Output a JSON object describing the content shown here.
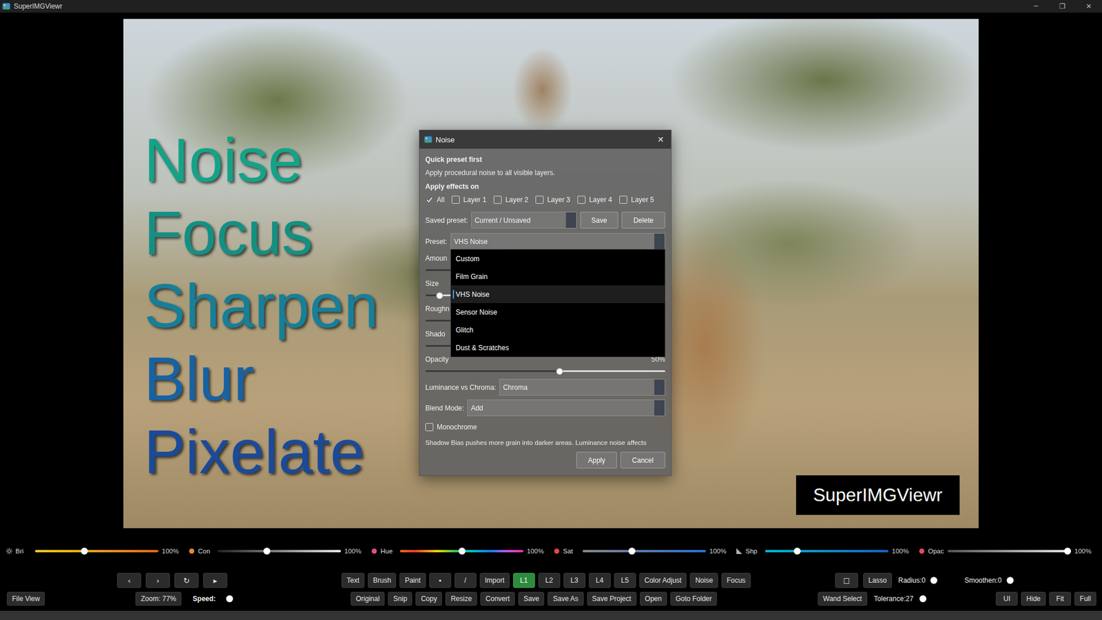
{
  "window": {
    "title": "SuperIMGViewr",
    "controls": [
      "─",
      "❐",
      "✕"
    ]
  },
  "canvas": {
    "text_layers": [
      {
        "text": "Noise",
        "color": "#14a387"
      },
      {
        "text": "Focus",
        "color": "#139083"
      },
      {
        "text": "Sharpen",
        "color": "#167f99"
      },
      {
        "text": "Blur",
        "color": "#1762a3"
      },
      {
        "text": "Pixelate",
        "color": "#1a4a98"
      }
    ],
    "watermark": "SuperIMGViewr"
  },
  "dialog": {
    "title": "Noise",
    "close": "✕",
    "heading": "Quick preset first",
    "description": "Apply procedural noise to all visible layers.",
    "apply_on_label": "Apply effects on",
    "apply_on": [
      {
        "label": "All",
        "checked": true
      },
      {
        "label": "Layer 1",
        "checked": false
      },
      {
        "label": "Layer 2",
        "checked": false
      },
      {
        "label": "Layer 3",
        "checked": false
      },
      {
        "label": "Layer 4",
        "checked": false
      },
      {
        "label": "Layer 5",
        "checked": false
      }
    ],
    "saved_preset": {
      "label": "Saved preset:",
      "value": "Current / Unsaved",
      "buttons": [
        "Save",
        "Delete"
      ]
    },
    "preset": {
      "label": "Preset:",
      "value": "VHS Noise",
      "expanded": true,
      "options": [
        {
          "label": "Custom",
          "selected": false
        },
        {
          "label": "Film Grain",
          "selected": false
        },
        {
          "label": "VHS Noise",
          "selected": true
        },
        {
          "label": "Sensor Noise",
          "selected": false
        },
        {
          "label": "Glitch",
          "selected": false
        },
        {
          "label": "Dust & Scratches",
          "selected": false
        }
      ]
    },
    "sliders": [
      {
        "label": "Amoun",
        "level": 0.35,
        "reading": ""
      },
      {
        "label": "Size",
        "level": 0.06,
        "reading": ""
      },
      {
        "label": "Roughn",
        "level": 0.25,
        "reading": ""
      },
      {
        "label": "Shado",
        "level": 0.3,
        "reading": ""
      },
      {
        "label": "Opacity",
        "level": 0.56,
        "reading": "50%"
      }
    ],
    "luminance": {
      "label": "Luminance vs Chroma:",
      "value": "Chroma"
    },
    "blend": {
      "label": "Blend Mode:",
      "value": "Add"
    },
    "monochrome": {
      "label": "Monochrome",
      "checked": false
    },
    "hint": "Shadow Bias pushes more grain into darker areas. Luminance noise affects",
    "buttons": [
      "Apply",
      "Cancel"
    ]
  },
  "adjust_sliders": [
    {
      "kind": "brightness",
      "label": "Bri",
      "level": 0.4,
      "reading": "100%"
    },
    {
      "kind": "contrast",
      "label": "Con",
      "level": 0.4,
      "reading": "100%"
    },
    {
      "kind": "hue",
      "label": "Hue",
      "level": 0.5,
      "reading": "100%"
    },
    {
      "kind": "saturation",
      "label": "Sat",
      "level": 0.4,
      "reading": "100%"
    },
    {
      "kind": "sharpness",
      "label": "Shp",
      "level": 0.26,
      "reading": "100%"
    },
    {
      "kind": "opacity",
      "label": "Opac",
      "level": 0.97,
      "reading": "100%"
    }
  ],
  "toolbar": {
    "nav": [
      "‹",
      "›",
      "↻",
      "▸"
    ],
    "tools": [
      {
        "label": "Text",
        "selected": false
      },
      {
        "label": "Brush",
        "selected": false
      },
      {
        "label": "Paint",
        "selected": false
      },
      {
        "label": "▪",
        "selected": false
      },
      {
        "label": "/",
        "selected": false
      },
      {
        "label": "Import",
        "selected": false
      },
      {
        "label": "L1",
        "selected": true
      },
      {
        "label": "L2",
        "selected": false
      },
      {
        "label": "L3",
        "selected": false
      },
      {
        "label": "L4",
        "selected": false
      },
      {
        "label": "L5",
        "selected": false
      },
      {
        "label": "Color Adjust",
        "selected": false
      },
      {
        "label": "Noise",
        "selected": false
      },
      {
        "label": "Focus",
        "selected": false
      }
    ],
    "selection_box": "□",
    "lasso": "Lasso",
    "radius": {
      "label": "Radius:0",
      "level": 0
    },
    "smoothen": {
      "label": "Smoothen:0",
      "level": 0
    }
  },
  "actions_bar": {
    "file_view": "File View",
    "zoom": "Zoom: 77%",
    "speed": {
      "label": "Speed:",
      "level": 0.8
    },
    "actions": [
      "Original",
      "Snip",
      "Copy",
      "Resize",
      "Convert",
      "Save",
      "Save As",
      "Save Project",
      "Open",
      "Goto Folder"
    ],
    "wand": "Wand Select",
    "tolerance": {
      "label": "Tolerance:27",
      "level": 0.1
    },
    "view": [
      "UI",
      "Hide",
      "Fit",
      "Full"
    ]
  }
}
